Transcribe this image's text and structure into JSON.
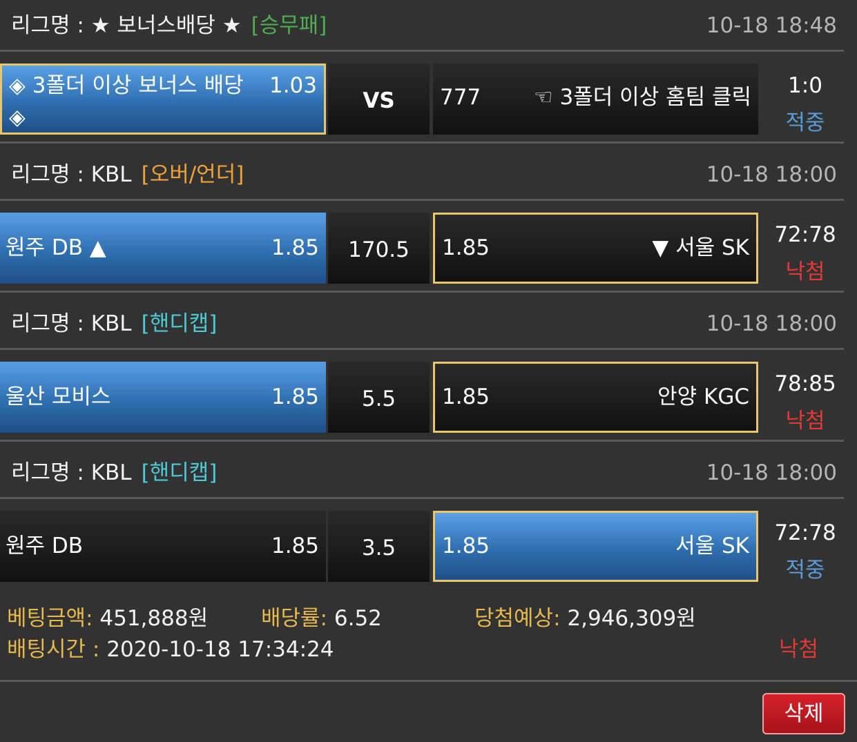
{
  "colors": {
    "background": "#323232",
    "selected_blue": "#2f6fb0",
    "highlight_border": "#e9c56b",
    "label_gold": "#e6b84f",
    "win_blue": "#5b9bd5",
    "lose_red": "#e53935",
    "type_green": "#4caf50",
    "type_orange": "#f0a23a",
    "type_cyan": "#4fc9d6"
  },
  "bets": [
    {
      "league_label": "리그명 : ★ 보너스배당 ★",
      "bet_type": "[승무패]",
      "bet_type_color": "#4caf50",
      "datetime": "10-18 18:48",
      "home_team": "◈ 3폴더 이상 보너스 배당 ◈",
      "home_odds": "1.03",
      "middle": "VS",
      "away_odds": "777",
      "away_team": "☜ 3폴더 이상 홈팀 클릭",
      "score": "1:0",
      "result": "적중",
      "result_color": "#5b9bd5",
      "selected_side": "home"
    },
    {
      "league_label": "리그명 : KBL",
      "bet_type": "[오버/언더]",
      "bet_type_color": "#f0a23a",
      "datetime": "10-18 18:00",
      "home_team": "원주 DB ▲",
      "home_odds": "1.85",
      "middle": "170.5",
      "away_odds": "1.85",
      "away_team": "▼ 서울 SK",
      "score": "72:78",
      "result": "낙첨",
      "result_color": "#e53935",
      "selected_side": "home"
    },
    {
      "league_label": "리그명 : KBL",
      "bet_type": "[핸디캡]",
      "bet_type_color": "#4fc9d6",
      "datetime": "10-18 18:00",
      "home_team": "울산 모비스",
      "home_odds": "1.85",
      "middle": "5.5",
      "away_odds": "1.85",
      "away_team": "안양 KGC",
      "score": "78:85",
      "result": "낙첨",
      "result_color": "#e53935",
      "selected_side": "home"
    },
    {
      "league_label": "리그명 : KBL",
      "bet_type": "[핸디캡]",
      "bet_type_color": "#4fc9d6",
      "datetime": "10-18 18:00",
      "home_team": "원주 DB",
      "home_odds": "1.85",
      "middle": "3.5",
      "away_odds": "1.85",
      "away_team": "서울 SK",
      "score": "72:78",
      "result": "적중",
      "result_color": "#5b9bd5",
      "selected_side": "away"
    }
  ],
  "summary": {
    "bet_amount_label": "베팅금액:",
    "bet_amount_value": "451,888원",
    "odds_label": "배당률:",
    "odds_value": "6.52",
    "expected_label": "당첨예상:",
    "expected_value": "2,946,309원",
    "time_label": "배팅시간 :",
    "time_value": "2020-10-18 17:34:24",
    "final_result": "낙첨",
    "final_result_color": "#e53935"
  },
  "delete_button_label": "삭제"
}
